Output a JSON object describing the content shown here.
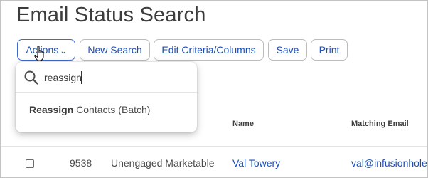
{
  "page": {
    "title": "Email Status Search"
  },
  "toolbar": {
    "actions_label": "Actions",
    "new_search_label": "New Search",
    "edit_criteria_label": "Edit Criteria/Columns",
    "save_label": "Save",
    "print_label": "Print"
  },
  "dropdown": {
    "search_value": "reassign",
    "items": [
      {
        "match": "Reassign",
        "rest": " Contacts (Batch)"
      }
    ]
  },
  "table": {
    "columns": [
      "Name",
      "Matching Email"
    ],
    "rows": [
      {
        "id": "9538",
        "status": "Unengaged Marketable",
        "name": "Val Towery",
        "email": "val@infusionhole."
      }
    ]
  },
  "icons": {
    "search": "search-icon",
    "chevron": "chevron-down-icon",
    "cursor": "hand-pointer-icon"
  },
  "colors": {
    "link": "#1e4fb4",
    "title": "#3c3c3c",
    "actions_border": "#3a6cd0"
  }
}
